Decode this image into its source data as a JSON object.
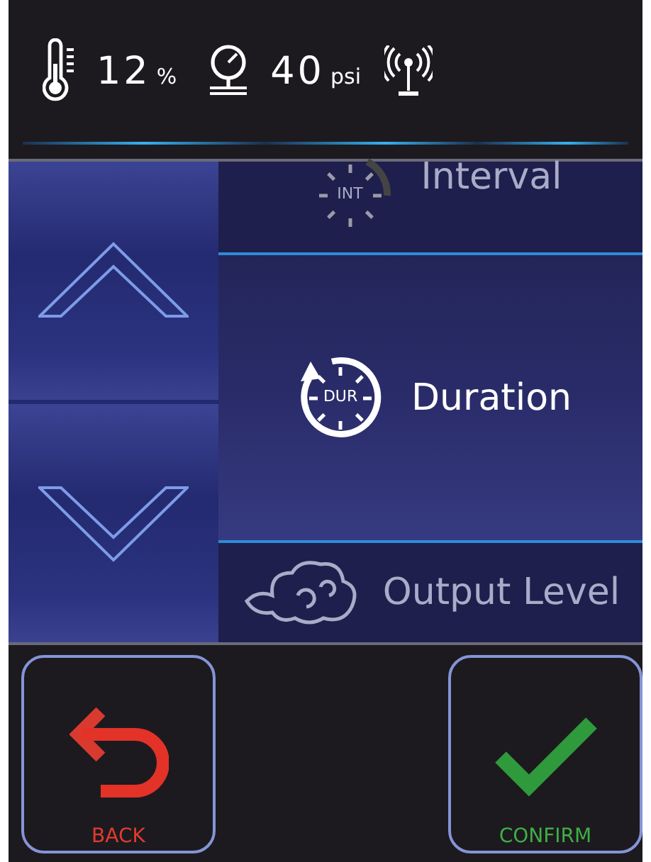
{
  "status_bar": {
    "humidity": {
      "value": "12",
      "unit": "%"
    },
    "pressure": {
      "value": "40",
      "unit": "psi"
    }
  },
  "menu": {
    "items": [
      {
        "kind": "interval",
        "icon_label": "INT",
        "label": "Interval",
        "selected": false
      },
      {
        "kind": "duration",
        "icon_label": "DUR",
        "label": "Duration",
        "selected": true
      },
      {
        "kind": "output",
        "label": "Output Level",
        "selected": false
      }
    ]
  },
  "buttons": [
    {
      "kind": "back",
      "label": "BACK"
    },
    {
      "kind": "confirm",
      "label": "CONFIRM"
    }
  ]
}
